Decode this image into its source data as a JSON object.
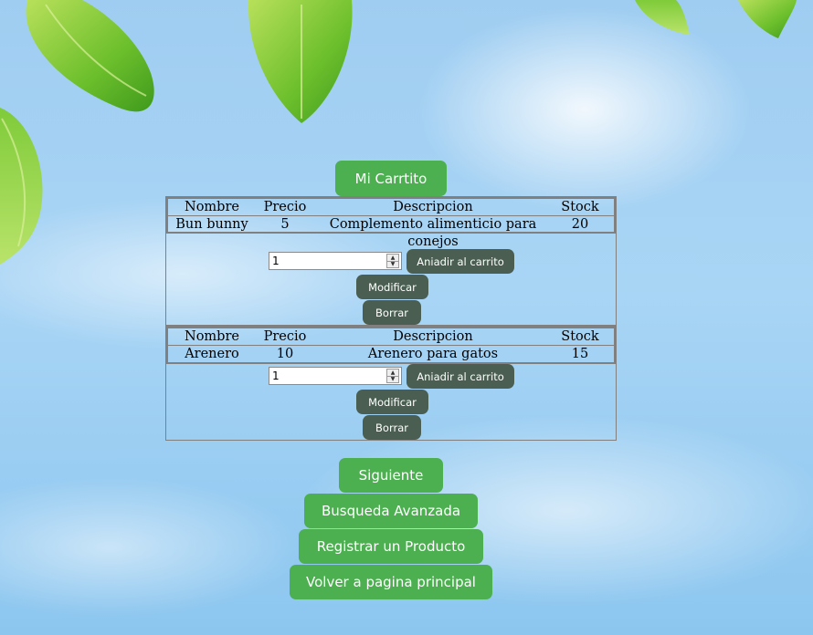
{
  "header_button": "Mi Carrtito",
  "columns": {
    "name": "Nombre",
    "price": "Precio",
    "description": "Descripcion",
    "stock": "Stock"
  },
  "products": [
    {
      "name": "Bun bunny",
      "price": "5",
      "description": "Complemento alimenticio para conejos",
      "stock": "20",
      "quantity": "1",
      "add_label": "Aniadir al carrito",
      "modify_label": "Modificar",
      "delete_label": "Borrar"
    },
    {
      "name": "Arenero",
      "price": "10",
      "description": "Arenero para gatos",
      "stock": "15",
      "quantity": "1",
      "add_label": "Aniadir al carrito",
      "modify_label": "Modificar",
      "delete_label": "Borrar"
    }
  ],
  "nav": {
    "next": "Siguiente",
    "advanced_search": "Busqueda Avanzada",
    "register_product": "Registrar un Producto",
    "back_home": "Volver a pagina principal"
  },
  "colors": {
    "green_button": "#4caf50",
    "dark_button": "#4a5f51",
    "sky": "#a9d5f5"
  },
  "icons": {
    "spinner_up": "▲",
    "spinner_down": "▼"
  }
}
